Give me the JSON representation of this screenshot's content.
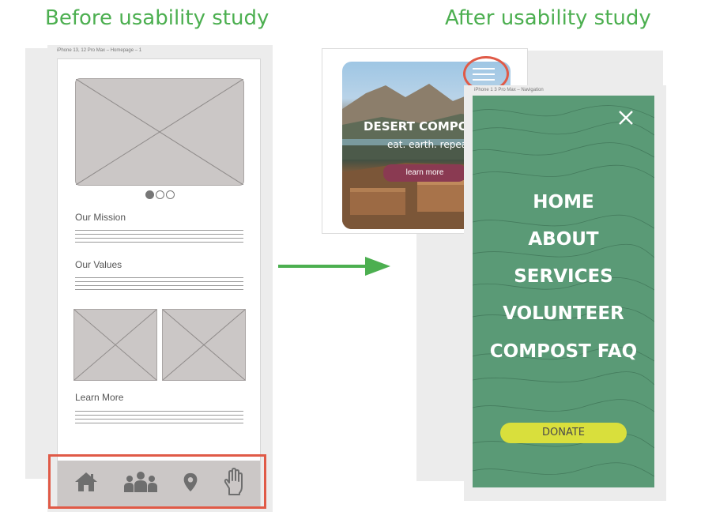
{
  "headings": {
    "before": "Before usability study",
    "after": "After usability study"
  },
  "wireframe": {
    "frame_label": "iPhone 13, 12 Pro Max – Homepage – 1",
    "carousel_dots": [
      true,
      false,
      false
    ],
    "sections": [
      {
        "label": "Our Mission"
      },
      {
        "label": "Our Values"
      },
      {
        "label": "Learn More"
      }
    ],
    "bottom_nav": [
      "home-icon",
      "community-icon",
      "location-icon",
      "volunteer-hand-icon"
    ]
  },
  "mockup": {
    "hero_title": "DESERT COMPO",
    "hero_tagline": "eat. earth. repea",
    "learn_more_label": "learn more",
    "nav_frame_label": "iPhone 1  3 Pro Max – Navigation",
    "menu_items": [
      "HOME",
      "ABOUT",
      "SERVICES",
      "VOLUNTEER",
      "COMPOST FAQ"
    ],
    "donate_label": "DONATE",
    "close_icon": "close-icon",
    "menu_icon": "hamburger-menu-icon"
  },
  "colors": {
    "heading": "#4caf50",
    "arrow": "#4caf50",
    "highlight": "#e05a47",
    "menu_bg": "#5a9a76",
    "donate_bg": "#d9df3c",
    "learn_more_bg": "#8a3a52"
  }
}
